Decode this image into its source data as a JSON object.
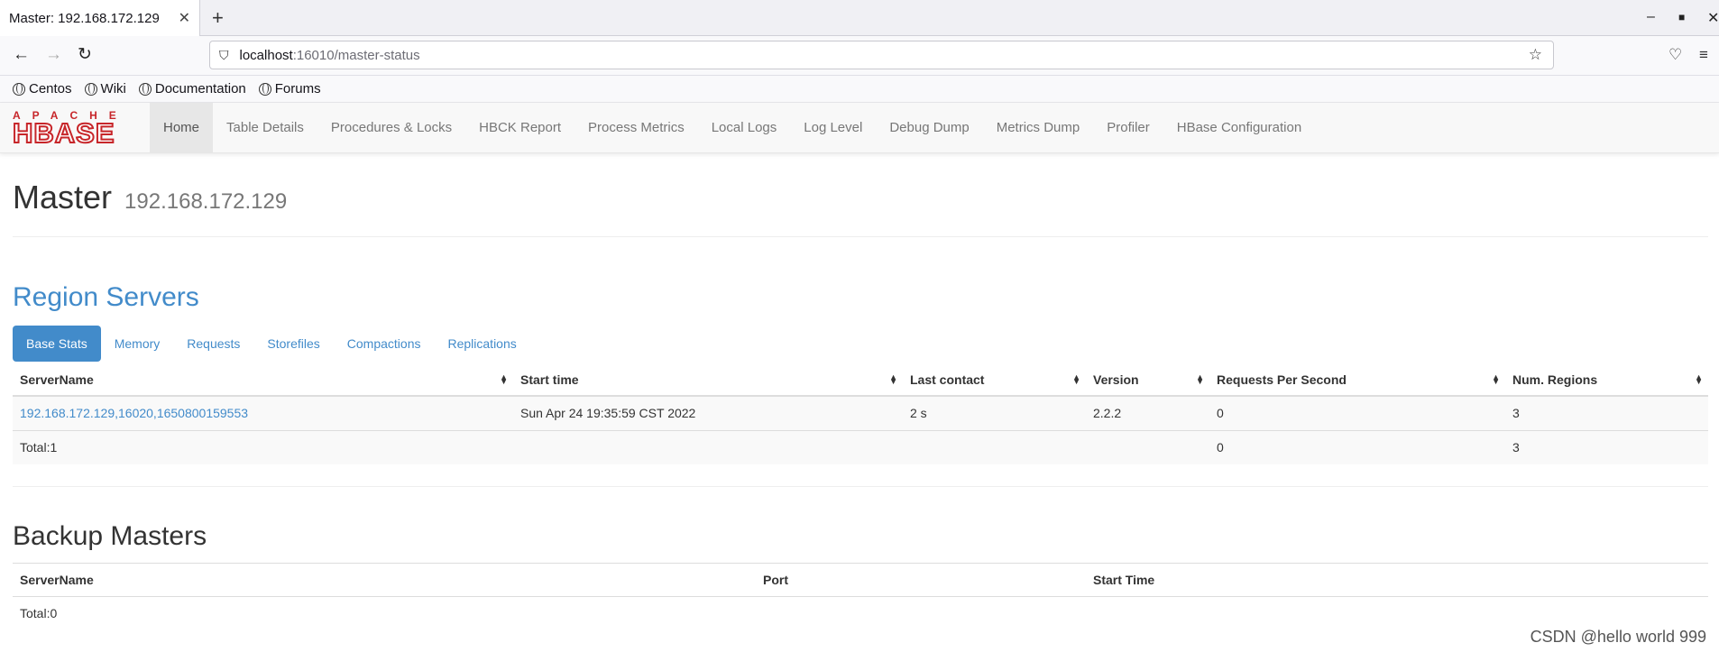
{
  "browser": {
    "tab_title": "Master: 192.168.172.129",
    "url_host": "localhost",
    "url_path": ":16010/master-status",
    "bookmarks": [
      "Centos",
      "Wiki",
      "Documentation",
      "Forums"
    ]
  },
  "hbase_nav": {
    "logo_top": "APACHE",
    "logo_main": "HBASE",
    "items": [
      "Home",
      "Table Details",
      "Procedures & Locks",
      "HBCK Report",
      "Process Metrics",
      "Local Logs",
      "Log Level",
      "Debug Dump",
      "Metrics Dump",
      "Profiler",
      "HBase Configuration"
    ]
  },
  "header": {
    "title": "Master",
    "subtitle": "192.168.172.129"
  },
  "region_servers": {
    "heading": "Region Servers",
    "tabs": [
      "Base Stats",
      "Memory",
      "Requests",
      "Storefiles",
      "Compactions",
      "Replications"
    ],
    "columns": [
      "ServerName",
      "Start time",
      "Last contact",
      "Version",
      "Requests Per Second",
      "Num. Regions"
    ],
    "rows": [
      [
        "192.168.172.129,16020,1650800159553",
        "Sun Apr 24 19:35:59 CST 2022",
        "2 s",
        "2.2.2",
        "0",
        "3"
      ]
    ],
    "total": [
      "Total:1",
      "",
      "",
      "",
      "0",
      "3"
    ]
  },
  "backup_masters": {
    "heading": "Backup Masters",
    "columns": [
      "ServerName",
      "Port",
      "Start Time"
    ],
    "total": "Total:0"
  },
  "watermark": "CSDN @hello world 999"
}
